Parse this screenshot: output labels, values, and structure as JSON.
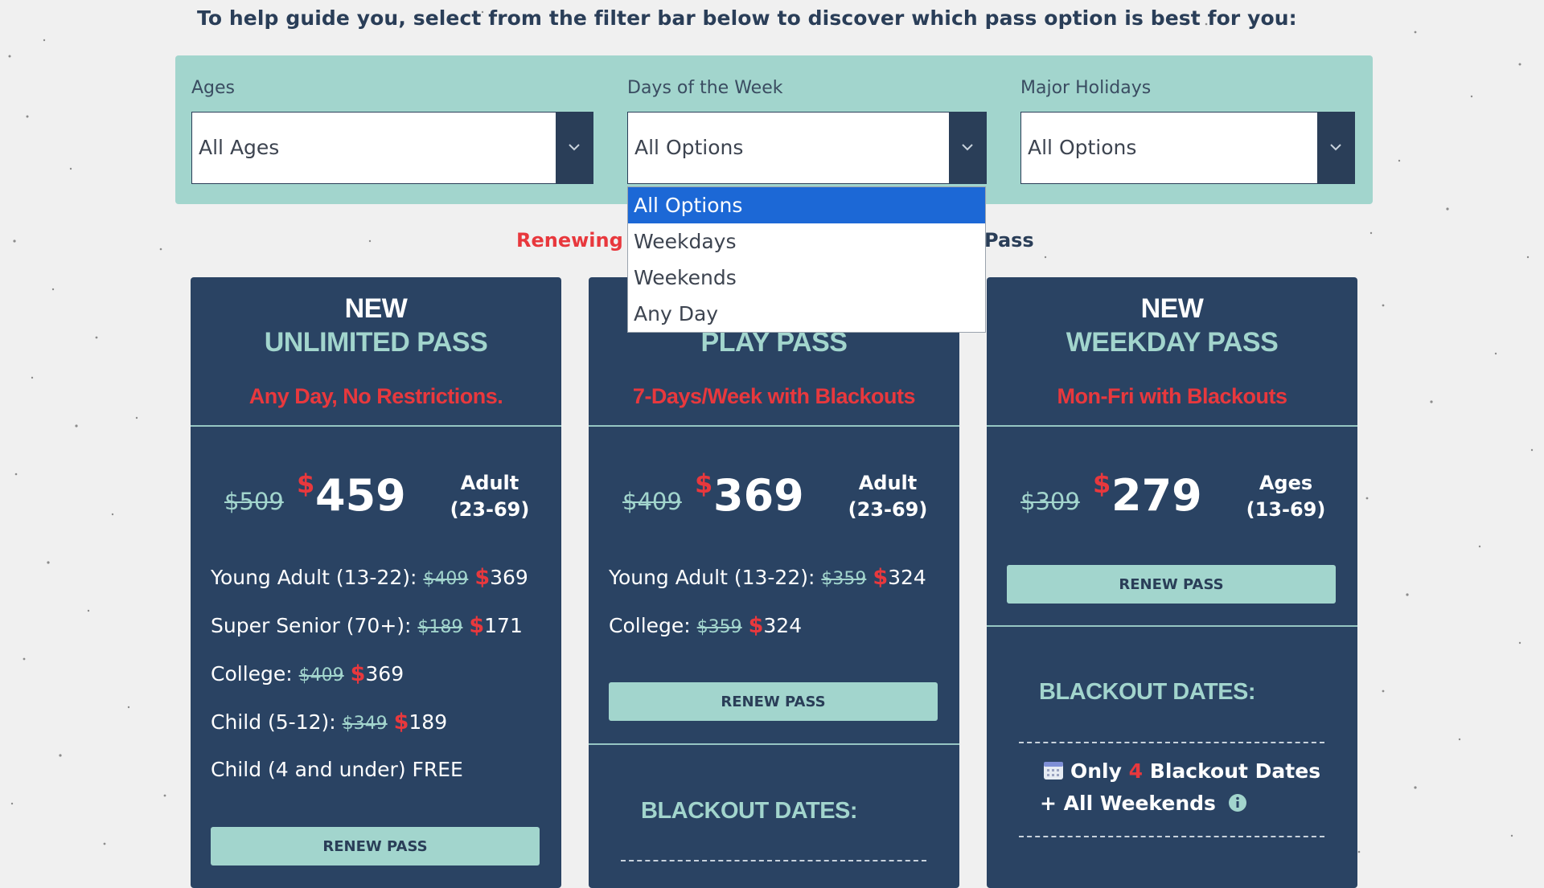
{
  "intro_text": "To help guide you, select from the filter bar below to discover which pass option is best for you:",
  "filters": {
    "ages": {
      "label": "Ages",
      "value": "All Ages"
    },
    "days": {
      "label": "Days of the Week",
      "value": "All Options"
    },
    "holidays": {
      "label": "Major Holidays",
      "value": "All Options"
    }
  },
  "days_dropdown": {
    "options": [
      "All Options",
      "Weekdays",
      "Weekends",
      "Any Day"
    ],
    "selected": "All Options"
  },
  "section_heading": {
    "left": "Renewing",
    "right": "Pass"
  },
  "colors": {
    "navy": "#2a4363",
    "teal": "#a2d5cd",
    "red": "#e8383d",
    "dropdown_highlight": "#1c68d6"
  },
  "cards": [
    {
      "new_label": "NEW",
      "name": "UNLIMITED PASS",
      "subtitle": "Any Day, No Restrictions.",
      "old_price": "$509",
      "currency": "$",
      "price": "459",
      "age_line1": "Adult",
      "age_line2": "(23-69)",
      "tiers": [
        {
          "label": "Young Adult (13-22):",
          "old": "$409",
          "new": "369"
        },
        {
          "label": "Super Senior (70+):",
          "old": "$189",
          "new": "171"
        },
        {
          "label": "College:",
          "old": "$409",
          "new": "369"
        },
        {
          "label": "Child (5-12):",
          "old": "$349",
          "new": "189"
        }
      ],
      "free_line": "Child (4 and under) FREE",
      "button": "RENEW PASS"
    },
    {
      "new_label": "",
      "name": "PLAY PASS",
      "subtitle": "7-Days/Week with Blackouts",
      "old_price": "$409",
      "currency": "$",
      "price": "369",
      "age_line1": "Adult",
      "age_line2": "(23-69)",
      "tiers": [
        {
          "label": "Young Adult (13-22):",
          "old": "$359",
          "new": "324"
        },
        {
          "label": "College:",
          "old": "$359",
          "new": "324"
        }
      ],
      "button": "RENEW PASS",
      "blackout_title": "BLACKOUT DATES:"
    },
    {
      "new_label": "NEW",
      "name": "WEEKDAY PASS",
      "subtitle": "Mon-Fri with Blackouts",
      "old_price": "$309",
      "currency": "$",
      "price": "279",
      "age_line1": "Ages",
      "age_line2": "(13-69)",
      "button": "RENEW PASS",
      "blackout_title": "BLACKOUT DATES:",
      "blackout_only": "Only",
      "blackout_count": "4",
      "blackout_rest": "Blackout Dates",
      "blackout_weekends": "+ All Weekends"
    }
  ]
}
